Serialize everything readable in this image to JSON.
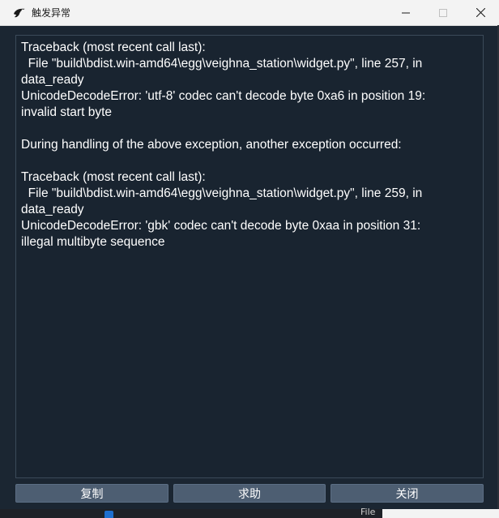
{
  "window": {
    "title": "触发异常"
  },
  "traceback_lines": [
    "Traceback (most recent call last):",
    "  File \"build\\bdist.win-amd64\\egg\\veighna_station\\widget.py\", line 257, in",
    "data_ready",
    "UnicodeDecodeError: 'utf-8' codec can't decode byte 0xa6 in position 19:",
    "invalid start byte",
    "",
    "During handling of the above exception, another exception occurred:",
    "",
    "Traceback (most recent call last):",
    "  File \"build\\bdist.win-amd64\\egg\\veighna_station\\widget.py\", line 259, in",
    "data_ready",
    "UnicodeDecodeError: 'gbk' codec can't decode byte 0xaa in position 31:",
    "illegal multibyte sequence"
  ],
  "buttons": {
    "copy_label": "复制",
    "help_label": "求助",
    "close_label": "关闭"
  },
  "background": {
    "file_fragment": "File"
  },
  "colors": {
    "window_bg": "#1b2632",
    "button_bg": "#4d5e72",
    "titlebar_bg": "#f3f3f3"
  },
  "icons": {
    "app": "app-logo-icon",
    "minimize": "minimize-icon",
    "maximize": "maximize-icon",
    "close": "close-icon"
  }
}
